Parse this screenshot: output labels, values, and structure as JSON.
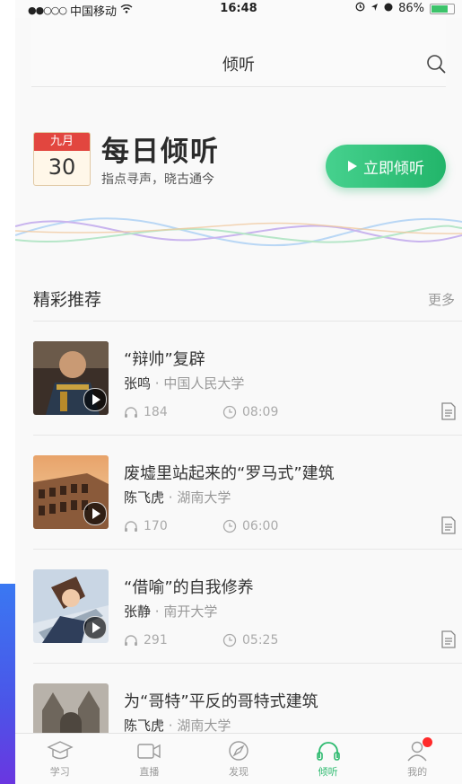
{
  "status_bar": {
    "carrier": "中国移动",
    "time": "16:48",
    "battery": "86%"
  },
  "nav": {
    "title": "倾听",
    "search_icon": "search-icon"
  },
  "daily": {
    "month": "九月",
    "day": "30",
    "title": "每日倾听",
    "subtitle": "指点寻声，晓古通今",
    "button_label": "立即倾听",
    "button_icon": "play-triangle-icon",
    "accent_color": "#2dba6f"
  },
  "section": {
    "title": "精彩推荐",
    "more_label": "更多"
  },
  "items": [
    {
      "title": "“辩帅”复辟",
      "author": "张鸣",
      "separator": "·",
      "school": "中国人民大学",
      "plays": "184",
      "duration": "08:09"
    },
    {
      "title": "废墟里站起来的“罗马式”建筑",
      "author": "陈飞虎",
      "separator": "·",
      "school": "湖南大学",
      "plays": "170",
      "duration": "06:00"
    },
    {
      "title": "“借喻”的自我修养",
      "author": "张静",
      "separator": "·",
      "school": "南开大学",
      "plays": "291",
      "duration": "05:25"
    },
    {
      "title": "为“哥特”平反的哥特式建筑",
      "author": "陈飞虎",
      "separator": "·",
      "school": "湖南大学",
      "plays": "",
      "duration": ""
    }
  ],
  "tabs": [
    {
      "label": "学习",
      "icon": "graduation-cap-icon"
    },
    {
      "label": "直播",
      "icon": "video-camera-icon"
    },
    {
      "label": "发现",
      "icon": "compass-icon"
    },
    {
      "label": "倾听",
      "icon": "headphones-icon",
      "active": true
    },
    {
      "label": "我的",
      "icon": "profile-icon",
      "badge": true
    }
  ]
}
